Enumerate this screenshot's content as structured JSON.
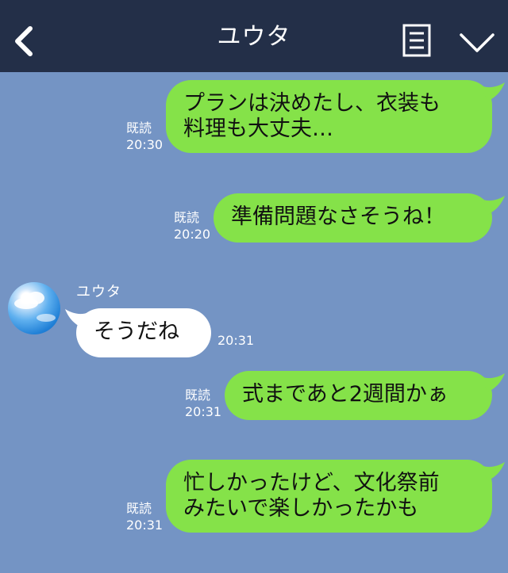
{
  "header": {
    "title": "ユウタ",
    "back_icon": "chevron-left-icon",
    "menu_icon": "list-icon",
    "collapse_icon": "chevron-down-icon"
  },
  "colors": {
    "header_bg": "#232f48",
    "chat_bg": "#7494c4",
    "outgoing_bubble": "#85e249",
    "incoming_bubble": "#ffffff"
  },
  "messages": [
    {
      "direction": "out",
      "text_lines": [
        "プランは決めたし、衣装も",
        "料理も大丈夫…"
      ],
      "read_label": "既読",
      "time": "20:30"
    },
    {
      "direction": "out",
      "text_lines": [
        "準備問題なさそうね！"
      ],
      "read_label": "既読",
      "time": "20:20"
    },
    {
      "direction": "in",
      "sender": "ユウタ",
      "text_lines": [
        "そうだね"
      ],
      "time": "20:31"
    },
    {
      "direction": "out",
      "text_lines": [
        "式まであと2週間かぁ"
      ],
      "read_label": "既読",
      "time": "20:31"
    },
    {
      "direction": "out",
      "text_lines": [
        "忙しかったけど、文化祭前",
        "みたいで楽しかったかも"
      ],
      "read_label": "既読",
      "time": "20:31"
    }
  ]
}
